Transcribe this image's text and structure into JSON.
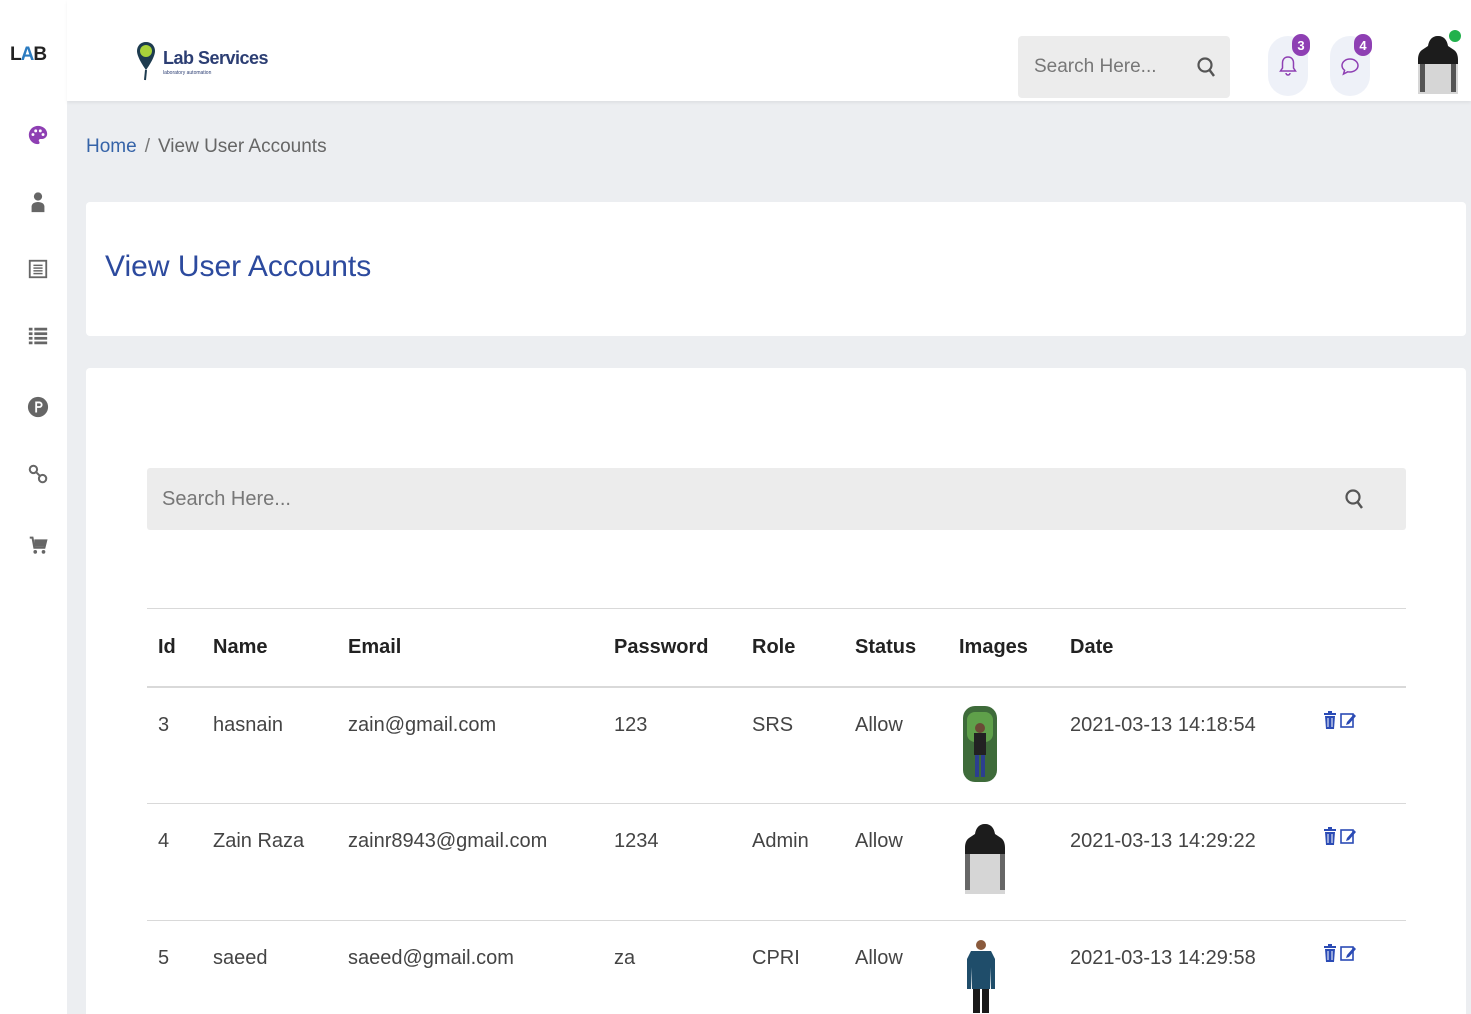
{
  "sidebar": {
    "logo": {
      "left": "L",
      "mid": "A",
      "right": "B"
    },
    "items": [
      {
        "icon": "palette-icon"
      },
      {
        "icon": "user-icon"
      },
      {
        "icon": "document-list-icon"
      },
      {
        "icon": "list-icon"
      },
      {
        "icon": "parking-p-icon"
      },
      {
        "icon": "link-icon"
      },
      {
        "icon": "cart-icon"
      }
    ]
  },
  "header": {
    "brand_title": "Lab Services",
    "brand_subtitle": "laboratory automation",
    "search_placeholder": "Search Here...",
    "notifications_count": "3",
    "messages_count": "4"
  },
  "breadcrumb": {
    "home": "Home",
    "separator": "/",
    "current": "View User Accounts"
  },
  "page_title": "View User Accounts",
  "table_search": {
    "placeholder": "Search Here..."
  },
  "table": {
    "columns": [
      "Id",
      "Name",
      "Email",
      "Password",
      "Role",
      "Status",
      "Images",
      "Date"
    ],
    "rows": [
      {
        "id": "3",
        "name": "hasnain",
        "email": "zain@gmail.com",
        "password": "123",
        "role": "SRS",
        "status": "Allow",
        "image": "person-photo",
        "date": "2021-03-13 14:18:54"
      },
      {
        "id": "4",
        "name": "Zain Raza",
        "email": "zainr8943@gmail.com",
        "password": "1234",
        "role": "Admin",
        "status": "Allow",
        "image": "hoodie-photo",
        "date": "2021-03-13 14:29:22"
      },
      {
        "id": "5",
        "name": "saeed",
        "email": "saeed@gmail.com",
        "password": "za",
        "role": "CPRI",
        "status": "Allow",
        "image": "shirt-photo",
        "date": "2021-03-13 14:29:58"
      }
    ]
  },
  "colors": {
    "accent": "#2c4a9e",
    "badge": "#8e3fb3",
    "online": "#22b14c",
    "action_blue": "#2b4bb5"
  }
}
